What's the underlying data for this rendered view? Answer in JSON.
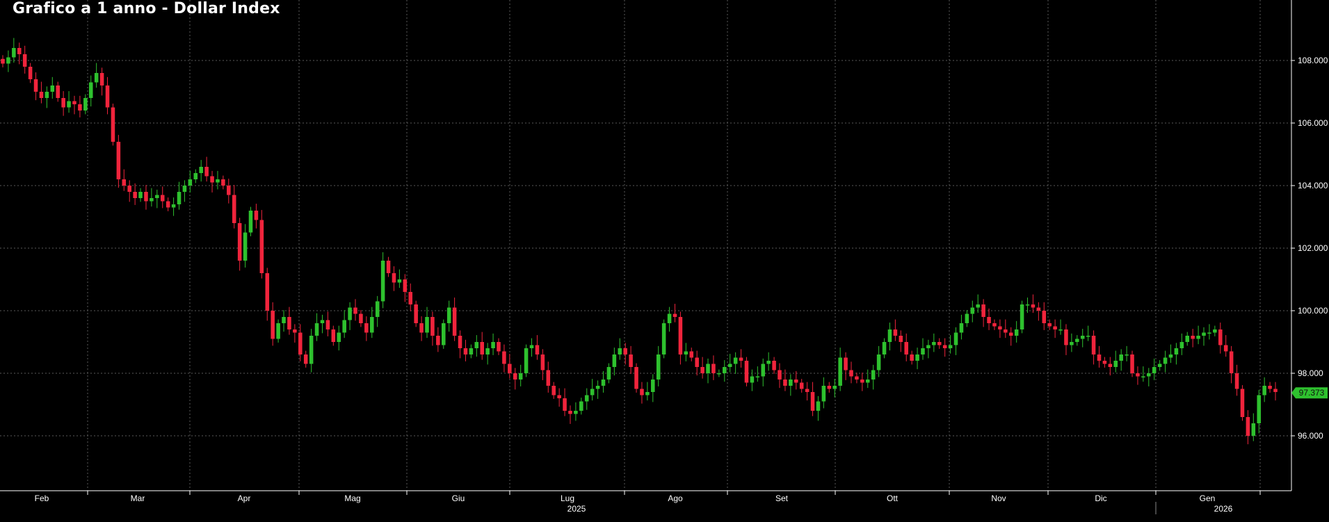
{
  "chart_data": {
    "type": "candlestick",
    "title": "Grafico a 1 anno - Dollar Index",
    "xlabel": "",
    "ylabel": "",
    "ylim": [
      94.5,
      110.5
    ],
    "grid": true,
    "legend": "none",
    "y_ticks": [
      "96.000",
      "98.000",
      "100.000",
      "102.000",
      "104.000",
      "106.000",
      "108.000"
    ],
    "x_month_labels": [
      "Feb",
      "Mar",
      "Apr",
      "Mag",
      "Giu",
      "Lug",
      "Ago",
      "Set",
      "Ott",
      "Nov",
      "Dic",
      "Gen"
    ],
    "x_year_labels": [
      "2025",
      "2026"
    ],
    "last_value_label": "97.373",
    "close_values": [
      107.9,
      108.1,
      108.4,
      108.2,
      107.8,
      107.4,
      107.0,
      106.8,
      107.0,
      107.2,
      106.8,
      106.5,
      106.7,
      106.6,
      106.4,
      106.8,
      107.3,
      107.6,
      107.2,
      106.5,
      105.4,
      104.2,
      104.0,
      103.8,
      103.6,
      103.8,
      103.5,
      103.6,
      103.7,
      103.5,
      103.3,
      103.4,
      103.8,
      104.0,
      104.2,
      104.4,
      104.6,
      104.3,
      104.1,
      104.2,
      104.0,
      103.7,
      102.8,
      101.6,
      102.5,
      103.2,
      102.9,
      101.2,
      100.0,
      99.1,
      99.6,
      99.8,
      99.4,
      99.3,
      98.6,
      98.3,
      99.2,
      99.6,
      99.7,
      99.4,
      99.0,
      99.3,
      99.7,
      100.1,
      99.9,
      99.6,
      99.3,
      99.8,
      100.3,
      101.6,
      101.2,
      100.9,
      101.0,
      100.6,
      100.2,
      99.6,
      99.3,
      99.8,
      99.2,
      98.9,
      99.6,
      100.1,
      99.2,
      98.8,
      98.6,
      98.8,
      99.0,
      98.6,
      98.8,
      99.0,
      98.7,
      98.3,
      98.0,
      97.8,
      98.0,
      98.8,
      98.9,
      98.6,
      98.1,
      97.6,
      97.3,
      97.2,
      96.8,
      96.7,
      96.8,
      97.1,
      97.3,
      97.5,
      97.6,
      97.8,
      98.2,
      98.6,
      98.8,
      98.6,
      98.2,
      97.5,
      97.3,
      97.4,
      97.8,
      98.6,
      99.6,
      99.9,
      99.8,
      98.6,
      98.7,
      98.5,
      98.2,
      98.0,
      98.3,
      98.0,
      98.0,
      98.2,
      98.3,
      98.5,
      98.4,
      97.7,
      97.9,
      97.9,
      98.3,
      98.4,
      98.1,
      97.8,
      97.6,
      97.8,
      97.7,
      97.5,
      97.4,
      96.8,
      97.1,
      97.6,
      97.5,
      97.6,
      98.5,
      98.1,
      97.9,
      97.8,
      97.7,
      97.8,
      98.1,
      98.6,
      99.0,
      99.4,
      99.2,
      99.0,
      98.6,
      98.4,
      98.6,
      98.8,
      98.9,
      99.0,
      98.9,
      98.8,
      98.9,
      99.3,
      99.6,
      99.9,
      100.1,
      100.2,
      99.8,
      99.6,
      99.5,
      99.4,
      99.3,
      99.2,
      99.4,
      100.2,
      100.2,
      100.1,
      100.0,
      99.6,
      99.5,
      99.4,
      99.4,
      98.9,
      99.0,
      99.1,
      99.2,
      99.2,
      98.6,
      98.4,
      98.3,
      98.2,
      98.4,
      98.6,
      98.6,
      98.0,
      97.9,
      97.9,
      98.0,
      98.2,
      98.3,
      98.5,
      98.6,
      98.8,
      99.0,
      99.2,
      99.1,
      99.2,
      99.3,
      99.3,
      99.4,
      98.9,
      98.7,
      98.0,
      97.5,
      96.6,
      96.0,
      96.4,
      97.3,
      97.6,
      97.5,
      97.4
    ]
  }
}
